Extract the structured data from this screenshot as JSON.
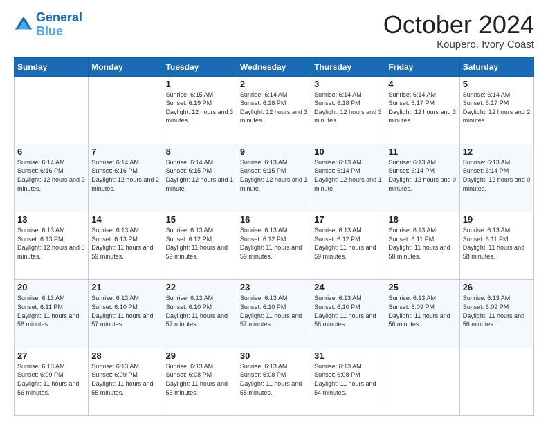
{
  "logo": {
    "line1": "General",
    "line2": "Blue"
  },
  "title": "October 2024",
  "location": "Koupero, Ivory Coast",
  "days_of_week": [
    "Sunday",
    "Monday",
    "Tuesday",
    "Wednesday",
    "Thursday",
    "Friday",
    "Saturday"
  ],
  "weeks": [
    [
      {
        "day": "",
        "sunrise": "",
        "sunset": "",
        "daylight": ""
      },
      {
        "day": "",
        "sunrise": "",
        "sunset": "",
        "daylight": ""
      },
      {
        "day": "1",
        "sunrise": "Sunrise: 6:15 AM",
        "sunset": "Sunset: 6:19 PM",
        "daylight": "Daylight: 12 hours and 3 minutes."
      },
      {
        "day": "2",
        "sunrise": "Sunrise: 6:14 AM",
        "sunset": "Sunset: 6:18 PM",
        "daylight": "Daylight: 12 hours and 3 minutes."
      },
      {
        "day": "3",
        "sunrise": "Sunrise: 6:14 AM",
        "sunset": "Sunset: 6:18 PM",
        "daylight": "Daylight: 12 hours and 3 minutes."
      },
      {
        "day": "4",
        "sunrise": "Sunrise: 6:14 AM",
        "sunset": "Sunset: 6:17 PM",
        "daylight": "Daylight: 12 hours and 3 minutes."
      },
      {
        "day": "5",
        "sunrise": "Sunrise: 6:14 AM",
        "sunset": "Sunset: 6:17 PM",
        "daylight": "Daylight: 12 hours and 2 minutes."
      }
    ],
    [
      {
        "day": "6",
        "sunrise": "Sunrise: 6:14 AM",
        "sunset": "Sunset: 6:16 PM",
        "daylight": "Daylight: 12 hours and 2 minutes."
      },
      {
        "day": "7",
        "sunrise": "Sunrise: 6:14 AM",
        "sunset": "Sunset: 6:16 PM",
        "daylight": "Daylight: 12 hours and 2 minutes."
      },
      {
        "day": "8",
        "sunrise": "Sunrise: 6:14 AM",
        "sunset": "Sunset: 6:15 PM",
        "daylight": "Daylight: 12 hours and 1 minute."
      },
      {
        "day": "9",
        "sunrise": "Sunrise: 6:13 AM",
        "sunset": "Sunset: 6:15 PM",
        "daylight": "Daylight: 12 hours and 1 minute."
      },
      {
        "day": "10",
        "sunrise": "Sunrise: 6:13 AM",
        "sunset": "Sunset: 6:14 PM",
        "daylight": "Daylight: 12 hours and 1 minute."
      },
      {
        "day": "11",
        "sunrise": "Sunrise: 6:13 AM",
        "sunset": "Sunset: 6:14 PM",
        "daylight": "Daylight: 12 hours and 0 minutes."
      },
      {
        "day": "12",
        "sunrise": "Sunrise: 6:13 AM",
        "sunset": "Sunset: 6:14 PM",
        "daylight": "Daylight: 12 hours and 0 minutes."
      }
    ],
    [
      {
        "day": "13",
        "sunrise": "Sunrise: 6:13 AM",
        "sunset": "Sunset: 6:13 PM",
        "daylight": "Daylight: 12 hours and 0 minutes."
      },
      {
        "day": "14",
        "sunrise": "Sunrise: 6:13 AM",
        "sunset": "Sunset: 6:13 PM",
        "daylight": "Daylight: 11 hours and 59 minutes."
      },
      {
        "day": "15",
        "sunrise": "Sunrise: 6:13 AM",
        "sunset": "Sunset: 6:12 PM",
        "daylight": "Daylight: 11 hours and 59 minutes."
      },
      {
        "day": "16",
        "sunrise": "Sunrise: 6:13 AM",
        "sunset": "Sunset: 6:12 PM",
        "daylight": "Daylight: 11 hours and 59 minutes."
      },
      {
        "day": "17",
        "sunrise": "Sunrise: 6:13 AM",
        "sunset": "Sunset: 6:12 PM",
        "daylight": "Daylight: 11 hours and 59 minutes."
      },
      {
        "day": "18",
        "sunrise": "Sunrise: 6:13 AM",
        "sunset": "Sunset: 6:11 PM",
        "daylight": "Daylight: 11 hours and 58 minutes."
      },
      {
        "day": "19",
        "sunrise": "Sunrise: 6:13 AM",
        "sunset": "Sunset: 6:11 PM",
        "daylight": "Daylight: 11 hours and 58 minutes."
      }
    ],
    [
      {
        "day": "20",
        "sunrise": "Sunrise: 6:13 AM",
        "sunset": "Sunset: 6:11 PM",
        "daylight": "Daylight: 11 hours and 58 minutes."
      },
      {
        "day": "21",
        "sunrise": "Sunrise: 6:13 AM",
        "sunset": "Sunset: 6:10 PM",
        "daylight": "Daylight: 11 hours and 57 minutes."
      },
      {
        "day": "22",
        "sunrise": "Sunrise: 6:13 AM",
        "sunset": "Sunset: 6:10 PM",
        "daylight": "Daylight: 11 hours and 57 minutes."
      },
      {
        "day": "23",
        "sunrise": "Sunrise: 6:13 AM",
        "sunset": "Sunset: 6:10 PM",
        "daylight": "Daylight: 11 hours and 57 minutes."
      },
      {
        "day": "24",
        "sunrise": "Sunrise: 6:13 AM",
        "sunset": "Sunset: 6:10 PM",
        "daylight": "Daylight: 11 hours and 56 minutes."
      },
      {
        "day": "25",
        "sunrise": "Sunrise: 6:13 AM",
        "sunset": "Sunset: 6:09 PM",
        "daylight": "Daylight: 11 hours and 56 minutes."
      },
      {
        "day": "26",
        "sunrise": "Sunrise: 6:13 AM",
        "sunset": "Sunset: 6:09 PM",
        "daylight": "Daylight: 11 hours and 56 minutes."
      }
    ],
    [
      {
        "day": "27",
        "sunrise": "Sunrise: 6:13 AM",
        "sunset": "Sunset: 6:09 PM",
        "daylight": "Daylight: 11 hours and 56 minutes."
      },
      {
        "day": "28",
        "sunrise": "Sunrise: 6:13 AM",
        "sunset": "Sunset: 6:09 PM",
        "daylight": "Daylight: 11 hours and 55 minutes."
      },
      {
        "day": "29",
        "sunrise": "Sunrise: 6:13 AM",
        "sunset": "Sunset: 6:08 PM",
        "daylight": "Daylight: 11 hours and 55 minutes."
      },
      {
        "day": "30",
        "sunrise": "Sunrise: 6:13 AM",
        "sunset": "Sunset: 6:08 PM",
        "daylight": "Daylight: 11 hours and 55 minutes."
      },
      {
        "day": "31",
        "sunrise": "Sunrise: 6:13 AM",
        "sunset": "Sunset: 6:08 PM",
        "daylight": "Daylight: 11 hours and 54 minutes."
      },
      {
        "day": "",
        "sunrise": "",
        "sunset": "",
        "daylight": ""
      },
      {
        "day": "",
        "sunrise": "",
        "sunset": "",
        "daylight": ""
      }
    ]
  ]
}
